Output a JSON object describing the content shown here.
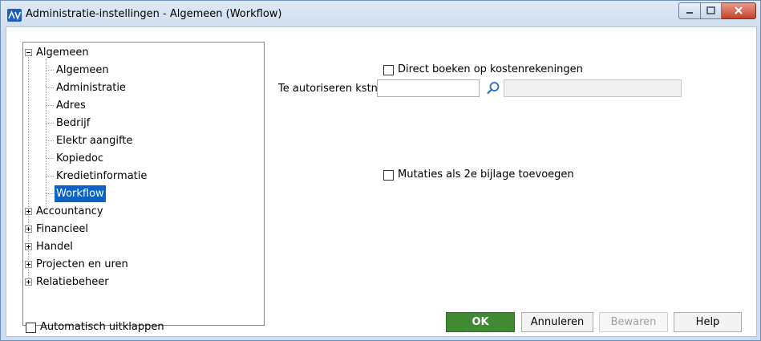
{
  "window": {
    "title": "Administratie-instellingen - Algemeen (Workflow)",
    "app_icon": "av-logo-icon",
    "controls": [
      "minimize-icon",
      "maximize-icon",
      "close-icon"
    ]
  },
  "tree": {
    "root_label": "Algemeen",
    "children": [
      "Algemeen",
      "Administratie",
      "Adres",
      "Bedrijf",
      "Elektr aangifte",
      "Kopiedoc",
      "Kredietinformatie",
      "Workflow"
    ],
    "selected": "Workflow",
    "collapsed_groups": [
      "Accountancy",
      "Financieel",
      "Handel",
      "Projecten en uren",
      "Relatiebeheer"
    ]
  },
  "form": {
    "direct_boeken_label": "Direct boeken op kostenrekeningen",
    "te_autoriseren_label": "Te autoriseren kstn:",
    "te_autoriseren_value": "",
    "te_autoriseren_description": "",
    "mutaties_label": "Mutaties als 2e bijlage toevoegen"
  },
  "footer": {
    "auto_uitklappen_label": "Automatisch uitklappen",
    "ok_label": "OK",
    "annuleren_label": "Annuleren",
    "bewaren_label": "Bewaren",
    "help_label": "Help"
  },
  "colors": {
    "ok_button": "#3f8a32",
    "selection": "#0a64c8",
    "close_button": "#c2432a"
  }
}
